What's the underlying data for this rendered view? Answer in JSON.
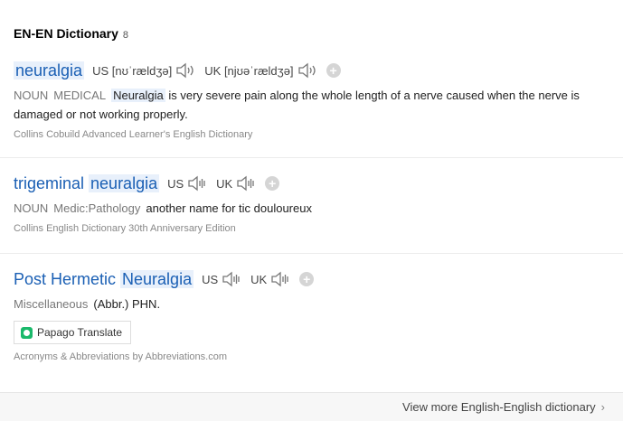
{
  "header": {
    "title": "EN-EN Dictionary",
    "count": "8"
  },
  "entries": [
    {
      "word_prefix": "",
      "word_highlight": "neuralgia",
      "us_label": "US",
      "us_ipa": "[nʊˈrældʒə]",
      "uk_label": "UK",
      "uk_ipa": "[njʊəˈrældʒə]",
      "pos": "NOUN",
      "domain": "MEDICAL",
      "def_highlight": "Neuralgia",
      "definition": " is very severe pain along the whole length of a nerve caused when the nerve is damaged or not working properly.",
      "source": "Collins Cobuild Advanced Learner's English Dictionary"
    },
    {
      "word_prefix": "trigeminal ",
      "word_highlight": "neuralgia",
      "us_label": "US",
      "uk_label": "UK",
      "pos": "NOUN",
      "domain": "Medic:Pathology",
      "definition": "another name for tic douloureux",
      "source": "Collins English Dictionary 30th Anniversary Edition"
    },
    {
      "word_prefix": "Post Hermetic ",
      "word_highlight": "Neuralgia",
      "us_label": "US",
      "uk_label": "UK",
      "pos": "Miscellaneous",
      "definition": "(Abbr.) PHN.",
      "papago_label": "Papago Translate",
      "source": "Acronyms & Abbreviations by Abbreviations.com"
    }
  ],
  "icons": {
    "speaker": "speaker-icon",
    "plus": "add-icon",
    "papago": "papago-logo-icon",
    "chevron": "chevron-right-icon"
  },
  "footer": {
    "view_more": "View more English-English dictionary",
    "chevron": "›"
  },
  "colors": {
    "link": "#1a5fb4",
    "highlight": "#e8f0fb",
    "papago": "#1bb96b"
  }
}
